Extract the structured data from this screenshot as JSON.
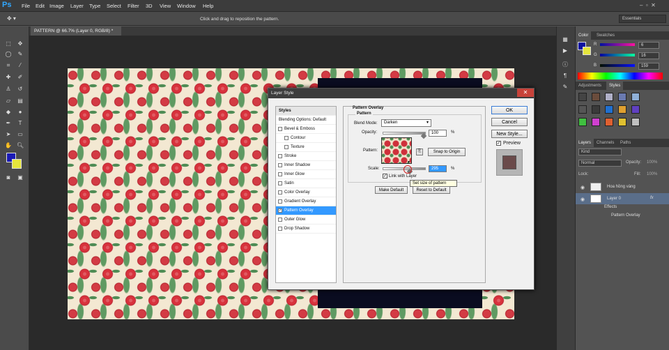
{
  "menubar": {
    "logo": "Ps",
    "items": [
      "File",
      "Edit",
      "Image",
      "Layer",
      "Type",
      "Select",
      "Filter",
      "3D",
      "View",
      "Window",
      "Help"
    ]
  },
  "options": {
    "hint": "Click and drag to reposition the pattern.",
    "workspace": "Essentials"
  },
  "document": {
    "tab": "PATTERN @ 66.7% (Layer 0, RGB/8) *"
  },
  "color_panel": {
    "tabs": [
      "Color",
      "Swatches"
    ],
    "r_label": "R",
    "g_label": "G",
    "b_label": "B",
    "r": "6",
    "g": "16",
    "b": "159",
    "fg": "#0a10a0",
    "bg": "#e5e53c"
  },
  "styles_panel": {
    "tabs": [
      "Adjustments",
      "Styles"
    ]
  },
  "layers_panel": {
    "tabs": [
      "Layers",
      "Channels",
      "Paths"
    ],
    "kind": "Kind",
    "mode": "Normal",
    "opacity_label": "Opacity:",
    "opacity": "100%",
    "lock_label": "Lock:",
    "fill_label": "Fill:",
    "fill": "100%",
    "layers": [
      {
        "name": "Hoa hồng vàng"
      },
      {
        "name": "Layer 0",
        "fx": "fx"
      }
    ],
    "effects_label": "Effects",
    "effect_item": "Pattern Overlay"
  },
  "dialog": {
    "title": "Layer Style",
    "list": [
      {
        "label": "Styles",
        "type": "head"
      },
      {
        "label": "Blending Options: Default",
        "type": "plain"
      },
      {
        "label": "Bevel & Emboss",
        "checked": false
      },
      {
        "label": "Contour",
        "checked": false,
        "indent": true
      },
      {
        "label": "Texture",
        "checked": false,
        "indent": true
      },
      {
        "label": "Stroke",
        "checked": false
      },
      {
        "label": "Inner Shadow",
        "checked": false
      },
      {
        "label": "Inner Glow",
        "checked": false
      },
      {
        "label": "Satin",
        "checked": false
      },
      {
        "label": "Color Overlay",
        "checked": false
      },
      {
        "label": "Gradient Overlay",
        "checked": false
      },
      {
        "label": "Pattern Overlay",
        "checked": true,
        "selected": true
      },
      {
        "label": "Outer Glow",
        "checked": false
      },
      {
        "label": "Drop Shadow",
        "checked": false
      }
    ],
    "section_title": "Pattern Overlay",
    "group_title": "Pattern",
    "blend_mode_label": "Blend Mode:",
    "blend_mode": "Darken",
    "opacity_label": "Opacity:",
    "opacity": "100",
    "opacity_unit": "%",
    "opacity_level": 100,
    "pattern_label": "Pattern:",
    "snap_button": "Snap to Origin",
    "scale_label": "Scale:",
    "scale": "295",
    "scale_unit": "%",
    "scale_level": 0.65,
    "link_label": "Link with Layer",
    "link_checked": true,
    "make_default": "Make Default",
    "reset_default": "Reset to Default",
    "tooltip": "Set size of pattern",
    "ok": "OK",
    "cancel": "Cancel",
    "new_style": "New Style...",
    "preview_label": "Preview",
    "preview_checked": true
  }
}
